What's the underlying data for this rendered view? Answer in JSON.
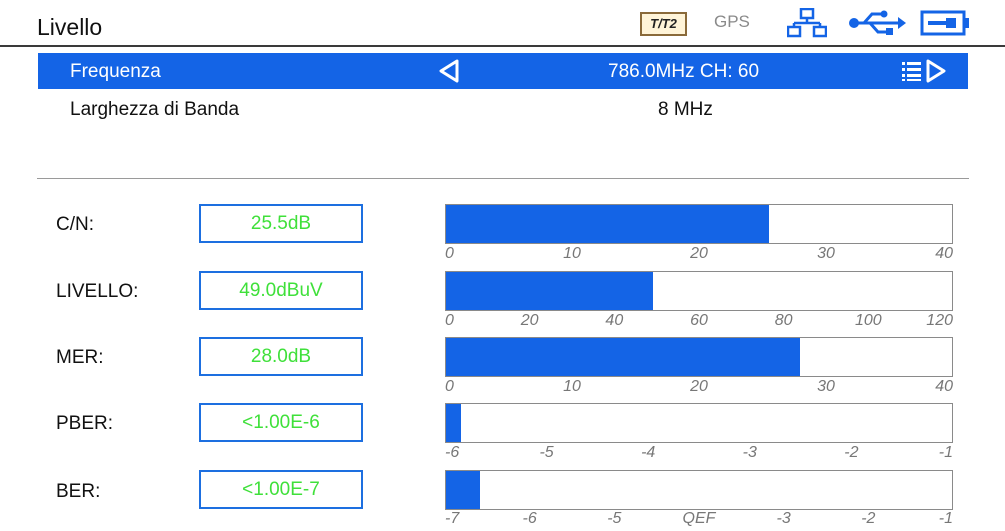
{
  "header": {
    "title": "Livello",
    "status": {
      "standard_badge": "T/T2",
      "gps_label": "GPS",
      "icons": [
        "t2-badge",
        "gps",
        "network-icon",
        "usb-icon",
        "battery-icon"
      ],
      "accent_color": "#1464e6"
    }
  },
  "tuning": {
    "frequency_label": "Frequenza",
    "frequency_value": "786.0MHz CH: 60",
    "bandwidth_label": "Larghezza di Banda",
    "bandwidth_value": "8 MHz"
  },
  "measurements": [
    {
      "id": "cn",
      "label": "C/N:",
      "value": "25.5dB",
      "level": 25.5,
      "scale_min": 0,
      "scale_max": 40,
      "ticks": [
        "0",
        "10",
        "20",
        "30",
        "40"
      ]
    },
    {
      "id": "livello",
      "label": "LIVELLO:",
      "value": "49.0dBuV",
      "level": 49.0,
      "scale_min": 0,
      "scale_max": 120,
      "ticks": [
        "0",
        "20",
        "40",
        "60",
        "80",
        "100",
        "120"
      ]
    },
    {
      "id": "mer",
      "label": "MER:",
      "value": "28.0dB",
      "level": 28.0,
      "scale_min": 0,
      "scale_max": 40,
      "ticks": [
        "0",
        "10",
        "20",
        "30",
        "40"
      ]
    },
    {
      "id": "pber",
      "label": "PBER:",
      "value": "<1.00E-6",
      "level": -5.85,
      "scale_min": -6,
      "scale_max": -1,
      "ticks": [
        "-6",
        "-5",
        "-4",
        "-3",
        "-2",
        "-1"
      ]
    },
    {
      "id": "ber",
      "label": "BER:",
      "value": "<1.00E-7",
      "level": -6.6,
      "scale_min": -7,
      "scale_max": -1,
      "ticks": [
        "-7",
        "-6",
        "-5",
        "QEF",
        "-3",
        "-2",
        "-1"
      ]
    }
  ],
  "colors": {
    "value_text": "#3fe03a",
    "bar_fill": "#1464e6",
    "highlight_row": "#1464e6"
  }
}
